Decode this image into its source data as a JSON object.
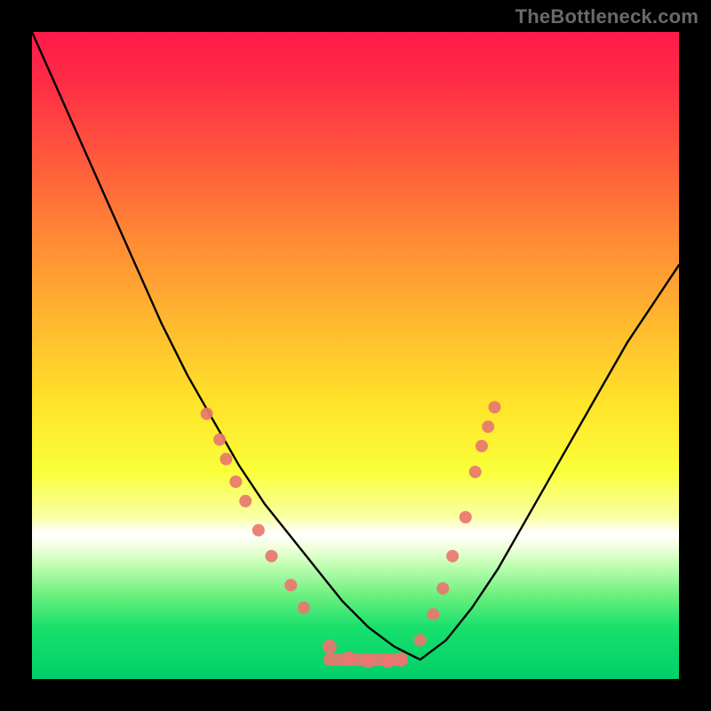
{
  "watermark": "TheBottleneck.com",
  "colors": {
    "marker": "#e8776f",
    "curve": "#000000",
    "frame": "#000000"
  },
  "chart_data": {
    "type": "line",
    "title": "",
    "xlabel": "",
    "ylabel": "",
    "xlim": [
      0,
      100
    ],
    "ylim": [
      0,
      100
    ],
    "grid": false,
    "legend": false,
    "series": [
      {
        "name": "bottleneck-curve",
        "x": [
          0,
          4,
          8,
          12,
          16,
          20,
          24,
          28,
          32,
          36,
          40,
          44,
          48,
          52,
          56,
          60,
          64,
          68,
          72,
          76,
          80,
          84,
          88,
          92,
          96,
          100
        ],
        "y": [
          100,
          91,
          82,
          73,
          64,
          55,
          47,
          40,
          33,
          27,
          22,
          17,
          12,
          8,
          5,
          3,
          6,
          11,
          17,
          24,
          31,
          38,
          45,
          52,
          58,
          64
        ]
      }
    ],
    "markers_left": [
      {
        "x": 27,
        "y": 41
      },
      {
        "x": 29,
        "y": 37
      },
      {
        "x": 30,
        "y": 34
      },
      {
        "x": 31.5,
        "y": 30.5
      },
      {
        "x": 33,
        "y": 27.5
      },
      {
        "x": 35,
        "y": 23
      },
      {
        "x": 37,
        "y": 19
      },
      {
        "x": 40,
        "y": 14.5
      },
      {
        "x": 42,
        "y": 11
      }
    ],
    "markers_valley": [
      {
        "x": 46,
        "y": 5
      },
      {
        "x": 49,
        "y": 3.2
      },
      {
        "x": 52,
        "y": 2.8
      },
      {
        "x": 55,
        "y": 2.8
      },
      {
        "x": 57,
        "y": 3
      }
    ],
    "markers_right": [
      {
        "x": 60,
        "y": 6
      },
      {
        "x": 62,
        "y": 10
      },
      {
        "x": 63.5,
        "y": 14
      },
      {
        "x": 65,
        "y": 19
      },
      {
        "x": 67,
        "y": 25
      },
      {
        "x": 68.5,
        "y": 32
      },
      {
        "x": 69.5,
        "y": 36
      },
      {
        "x": 70.5,
        "y": 39
      },
      {
        "x": 71.5,
        "y": 42
      }
    ],
    "valley_ridge": {
      "x_start": 46,
      "x_end": 57,
      "y": 3
    }
  }
}
